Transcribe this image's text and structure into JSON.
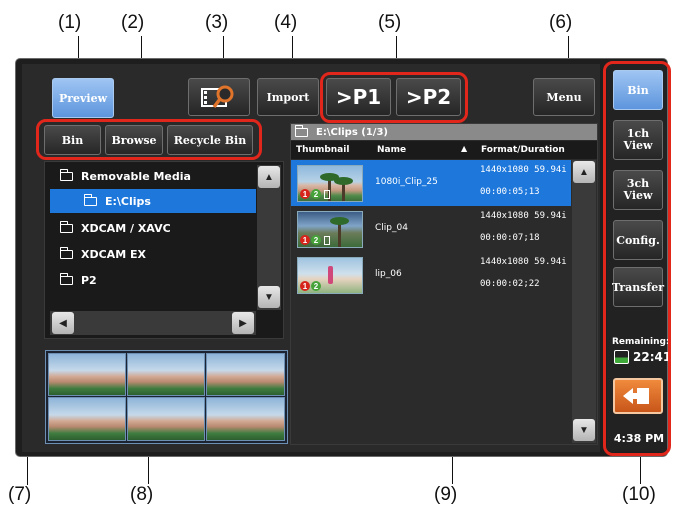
{
  "callouts": [
    "(1)",
    "(2)",
    "(3)",
    "(4)",
    "(5)",
    "(6)",
    "(7)",
    "(8)",
    "(9)",
    "(10)"
  ],
  "toolbar": {
    "preview_label": "Preview",
    "import_label": "Import",
    "p1_label": ">P1",
    "p2_label": ">P2",
    "menu_label": "Menu"
  },
  "tabs": [
    {
      "label": "Bin"
    },
    {
      "label": "Browse"
    },
    {
      "label": "Recycle Bin"
    }
  ],
  "tree": {
    "items": [
      {
        "label": "Removable Media"
      },
      {
        "label": "E:\\Clips"
      },
      {
        "label": "XDCAM / XAVC"
      },
      {
        "label": "XDCAM EX"
      },
      {
        "label": "P2"
      }
    ]
  },
  "clip_list": {
    "path": "E:\\Clips (1/3)",
    "columns": [
      "Thumbnail",
      "Name",
      "Format/Duration"
    ],
    "rows": [
      {
        "name": "1080i_Clip_25",
        "format": "1440x1080 59.94i",
        "duration": "00:00:05;13"
      },
      {
        "name": "Clip_04",
        "format": "1440x1080 59.94i",
        "duration": "00:00:07;18"
      },
      {
        "name": "lip_06",
        "format": "1440x1080 59.94i",
        "duration": "00:00:02;22"
      }
    ],
    "badges": [
      "1",
      "2"
    ]
  },
  "sidebar": {
    "bin_label": "Bin",
    "view1_line1": "1ch",
    "view1_line2": "View",
    "view3_line1": "3ch",
    "view3_line2": "View",
    "config_label": "Config.",
    "transfer_label": "Transfer",
    "remaining_label": "Remaining:",
    "remaining_value": "22:41",
    "clock": "4:38 PM"
  },
  "colors": {
    "accent_blue": "#1e78dc",
    "highlight_red": "#e1261c",
    "button_orange": "#e0742a"
  }
}
